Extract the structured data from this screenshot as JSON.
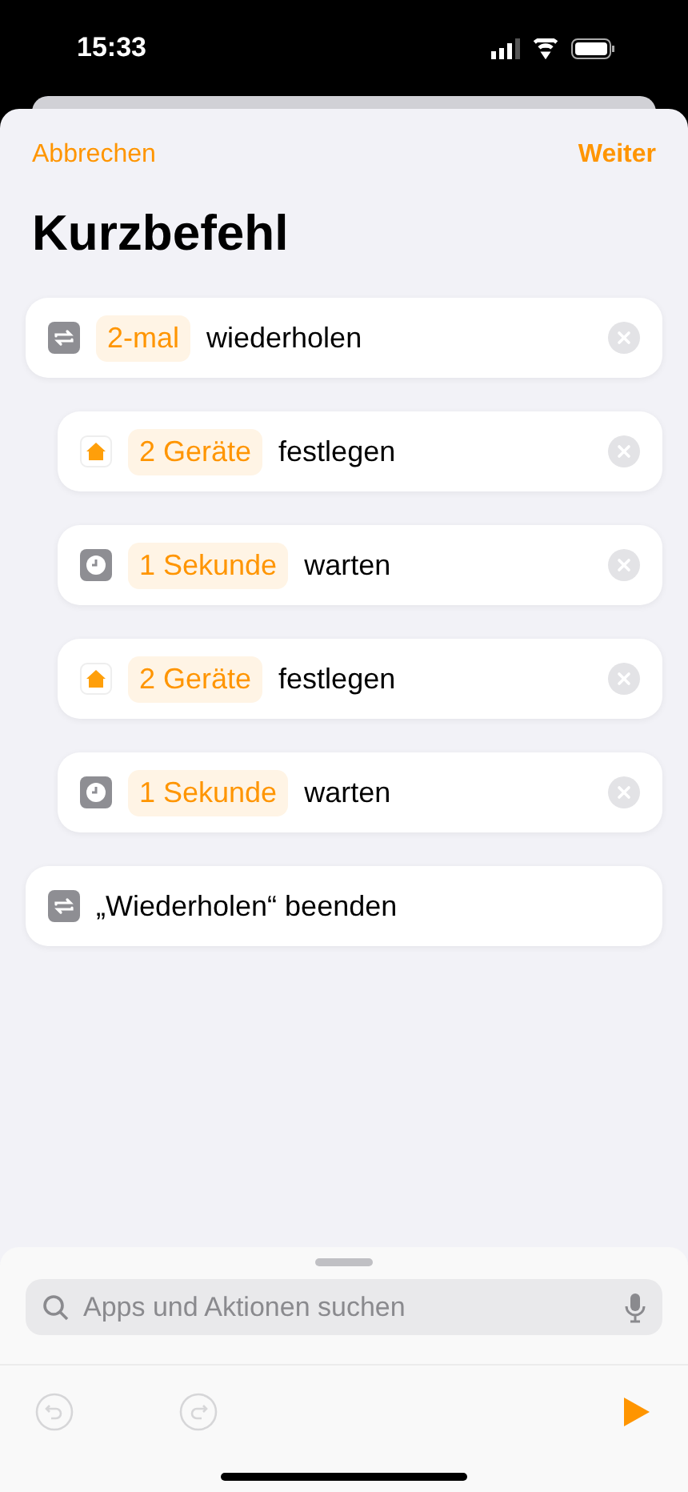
{
  "status_bar": {
    "time": "15:33"
  },
  "nav": {
    "cancel": "Abbrechen",
    "next": "Weiter"
  },
  "title": "Kurzbefehl",
  "actions": [
    {
      "kind": "repeat",
      "parameter": "2-mal",
      "text": "wiederholen",
      "children": [
        {
          "kind": "home",
          "parameter": "2 Geräte",
          "text": "festlegen"
        },
        {
          "kind": "wait",
          "parameter": "1 Sekunde",
          "text": "warten"
        },
        {
          "kind": "home",
          "parameter": "2 Geräte",
          "text": "festlegen"
        },
        {
          "kind": "wait",
          "parameter": "1 Sekunde",
          "text": "warten"
        }
      ]
    },
    {
      "kind": "repeat",
      "text": "„Wiederholen“ beenden"
    }
  ],
  "search": {
    "placeholder": "Apps und Aktionen suchen"
  },
  "toolbar": {
    "undo_disabled": true,
    "redo_disabled": true
  }
}
